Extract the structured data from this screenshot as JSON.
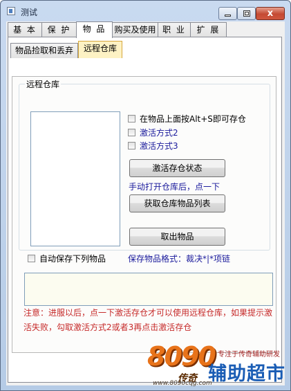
{
  "window": {
    "title": "测试",
    "minimize_glyph": "",
    "close_glyph": "x"
  },
  "tabs": [
    "基 本",
    "保 护",
    "物 品",
    "购买及使用",
    "职 业",
    "扩 展"
  ],
  "subtabs": [
    "物品捡取和丢弃",
    "远程仓库"
  ],
  "group_title": "远程仓库",
  "checkboxes": {
    "alt_s": "在物品上面按Alt+S即可存仓",
    "mode2": "激活方式2",
    "mode3": "激活方式3",
    "auto_save": "自动保存下列物品"
  },
  "buttons": {
    "activate": "激活存仓状态",
    "get_list": "获取仓库物品列表",
    "take_out": "取出物品"
  },
  "hints": {
    "manual_open": "手动打开仓库后，点一下",
    "save_format": "保存物品格式：裁决*|*项链"
  },
  "note_lines": [
    "注意：进服以后，点一下激活存仓才可以使用远程仓库，如果提示激",
    "活失败，勾取激活方式2或者3再点击激活存仓"
  ],
  "watermark": {
    "logo": "8090",
    "logo_sub": "传奇",
    "slogan": "专注于传奇辅助研发",
    "brand": "辅助超市",
    "url": "www.8090cqg.com"
  }
}
